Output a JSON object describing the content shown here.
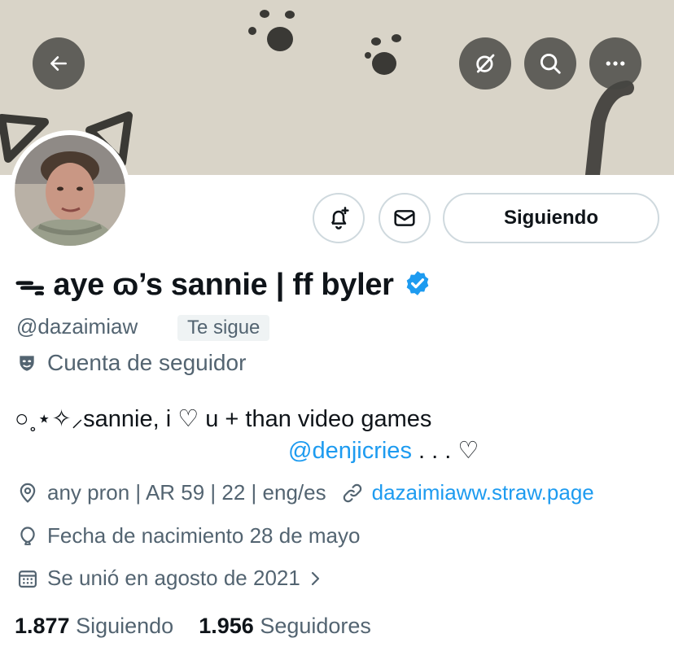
{
  "profile": {
    "display_name": "ᯓ aye ɷ’s sannie | ff byler",
    "handle": "@dazaimiaw",
    "follows_you_label": "Te sigue",
    "account_type": "Cuenta de seguidor",
    "bio_line1": "○˳⋆✧⸝sannie, i ♡ u + than video games",
    "bio_mention": "@denjicries",
    "bio_line2_suffix": " . . . ♡",
    "location": "any pron | AR 59 | 22 | eng/es",
    "website": "dazaimiaww.straw.page",
    "birthdate": "Fecha de nacimiento 28 de mayo",
    "joined": "Se unió en agosto de 2021",
    "following_count": "1.877",
    "following_label": "Siguiendo",
    "followers_count": "1.956",
    "followers_label": "Seguidores"
  },
  "actions": {
    "follow_state_label": "Siguiendo"
  },
  "icons": {
    "back": "arrow-left-icon",
    "translate": "grok-icon",
    "search": "search-icon",
    "more": "more-horizontal-icon",
    "notifications": "bell-plus-icon",
    "message": "envelope-icon",
    "verified": "verified-badge-icon",
    "location": "location-pin-icon",
    "website": "link-icon",
    "birthday": "balloon-icon",
    "joined": "calendar-icon"
  },
  "colors": {
    "accent": "#1d9bf0",
    "secondary_text": "#536471",
    "border": "#cfd9de",
    "banner": "#d9d4c8"
  }
}
